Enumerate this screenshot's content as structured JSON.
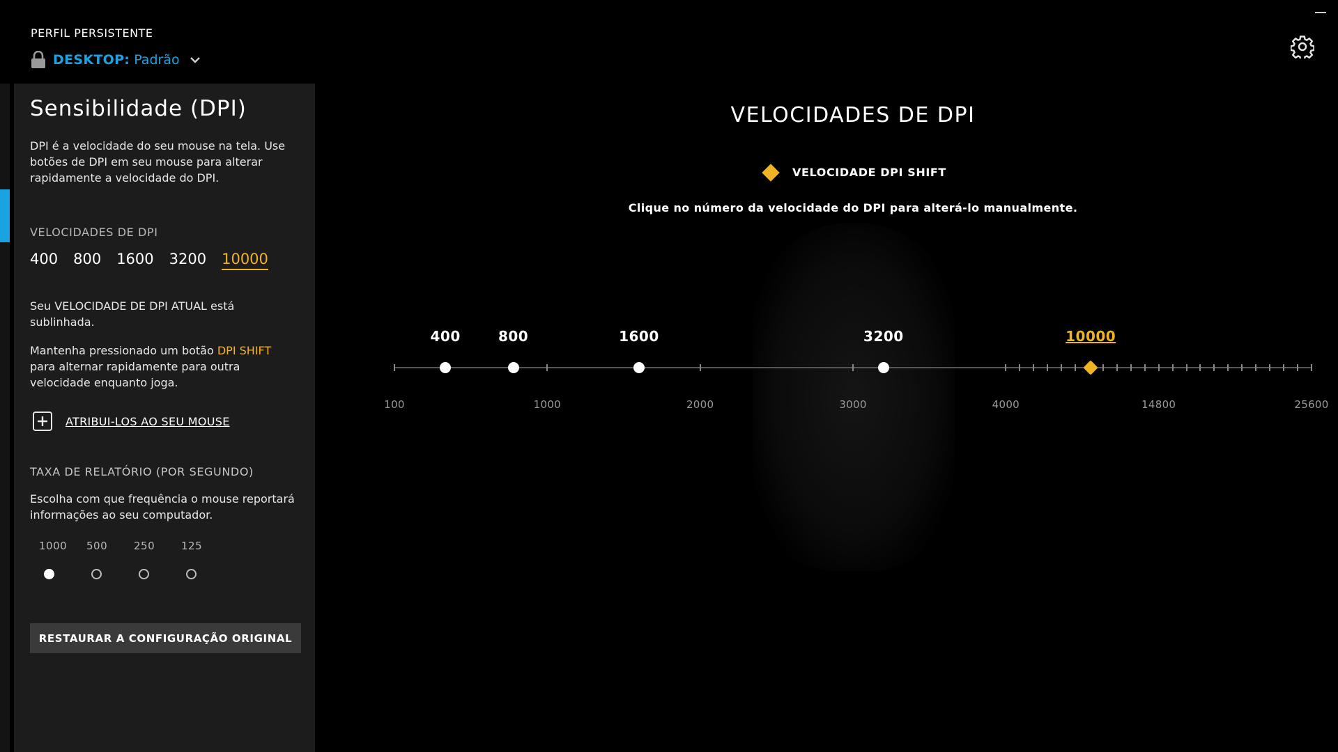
{
  "header": {
    "profile_caption": "PERFIL PERSISTENTE",
    "profile_name": "DESKTOP:",
    "profile_value": "Padrão"
  },
  "colors": {
    "accent": "#1aa3e3",
    "shift": "#f0b324",
    "panel": "#1c1c1c",
    "background": "#000000"
  },
  "icons": {
    "lock": "lock-icon",
    "chevron": "chevron-down-icon",
    "settings": "gear-icon",
    "minimize": "minimize-icon",
    "assign": "plus-square-icon",
    "shift": "diamond-icon"
  },
  "panel": {
    "title": "Sensibilidade (DPI)",
    "description": "DPI é a velocidade do seu mouse na tela. Use botões de DPI em seu mouse para alterar rapidamente a velocidade do DPI.",
    "dpi_section_label": "VELOCIDADES DE DPI",
    "dpi_values": [
      "400",
      "800",
      "1600",
      "3200",
      "10000"
    ],
    "active_dpi_index": 4,
    "current_note": "Seu VELOCIDADE DE DPI ATUAL está sublinhada.",
    "shift_note_before": "Mantenha pressionado um botão ",
    "shift_note_accent": "DPI SHIFT",
    "shift_note_after": " para alternar rapidamente para outra velocidade enquanto joga.",
    "assign_link": "ATRIBUI-LOS AO SEU MOUSE",
    "rate_section_label": "TAXA DE RELATÓRIO (POR SEGUNDO)",
    "rate_description": "Escolha com que frequência o mouse reportará informações ao seu computador.",
    "rate_options": [
      "1000",
      "500",
      "250",
      "125"
    ],
    "rate_selected_index": 0,
    "restore_button": "RESTAURAR A CONFIGURAÇÃO ORIGINAL"
  },
  "main": {
    "title": "VELOCIDADES DE DPI",
    "legend_label": "VELOCIDADE DPI SHIFT",
    "hint": "Clique no número da velocidade do DPI para alterá-lo manualmente."
  },
  "slider": {
    "axis_labels": [
      "100",
      "1000",
      "2000",
      "3000",
      "4000",
      "14800",
      "25600"
    ],
    "handles": [
      {
        "value": "400",
        "dpi": 400,
        "shift": false
      },
      {
        "value": "800",
        "dpi": 800,
        "shift": false
      },
      {
        "value": "1600",
        "dpi": 1600,
        "shift": false
      },
      {
        "value": "3200",
        "dpi": 3200,
        "shift": false
      },
      {
        "value": "10000",
        "dpi": 10000,
        "shift": true
      }
    ]
  }
}
